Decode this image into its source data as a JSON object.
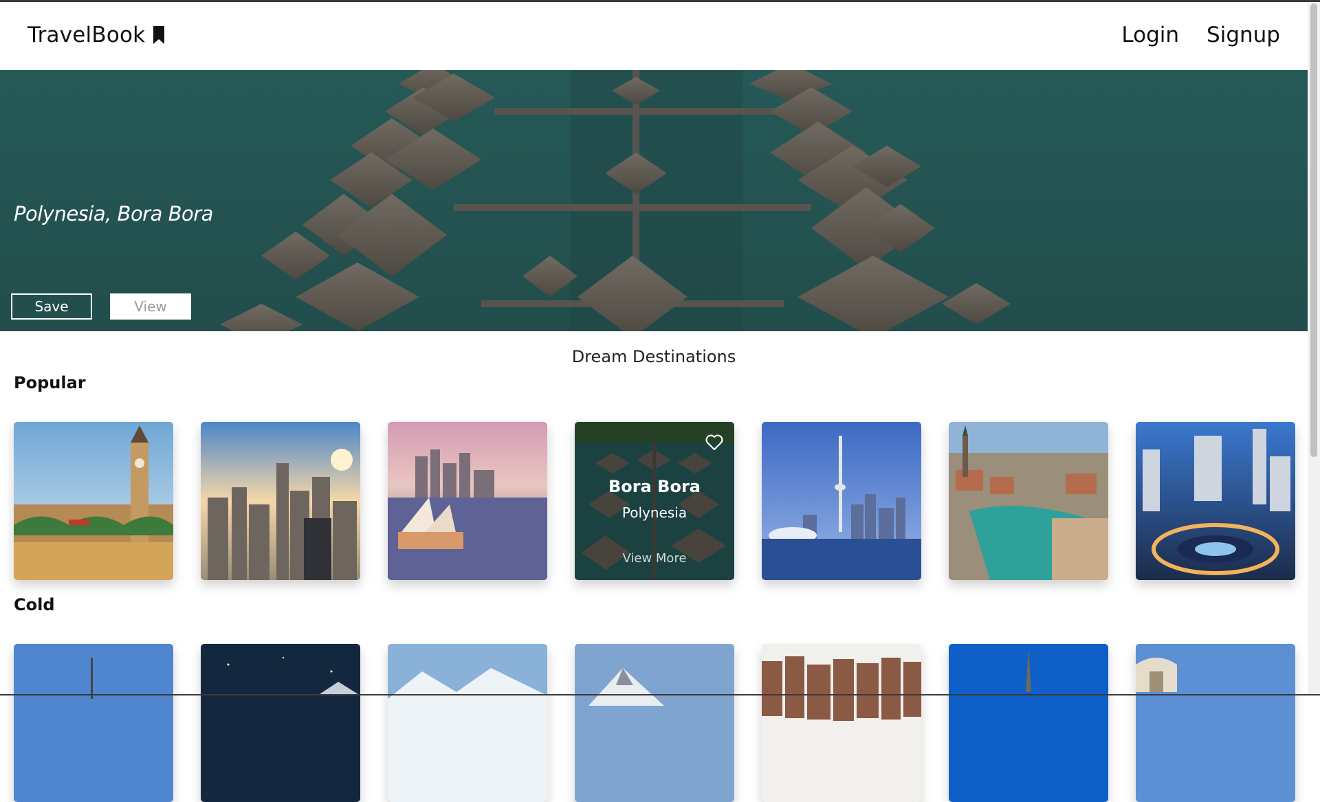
{
  "app": {
    "brand": "TravelBook",
    "brand_icon": "bookmark-icon"
  },
  "nav": {
    "login": "Login",
    "signup": "Signup"
  },
  "hero": {
    "title": "Polynesia, Bora Bora",
    "save_label": "Save",
    "view_label": "View"
  },
  "main": {
    "heading": "Dream Destinations",
    "categories": [
      {
        "label": "Popular",
        "cards": [
          {
            "scene": "london-big-ben"
          },
          {
            "scene": "new-york-skyline"
          },
          {
            "scene": "sydney-opera-house"
          },
          {
            "scene": "bora-bora-bungalows",
            "city": "Bora Bora",
            "country": "Polynesia",
            "more": "View More",
            "icon": "heart-icon"
          },
          {
            "scene": "toronto-cn-tower"
          },
          {
            "scene": "zurich-river"
          },
          {
            "scene": "jakarta-roundabout"
          }
        ]
      },
      {
        "label": "Cold",
        "cards": [
          {
            "scene": "blue-sky-tower"
          },
          {
            "scene": "night-sky-mountain"
          },
          {
            "scene": "snowy-peaks"
          },
          {
            "scene": "alpine-summit"
          },
          {
            "scene": "amsterdam-houses"
          },
          {
            "scene": "church-spire-blue"
          },
          {
            "scene": "european-archway"
          }
        ]
      }
    ]
  },
  "colors": {
    "hero_water": "#2f6e6a",
    "text": "#111111"
  }
}
